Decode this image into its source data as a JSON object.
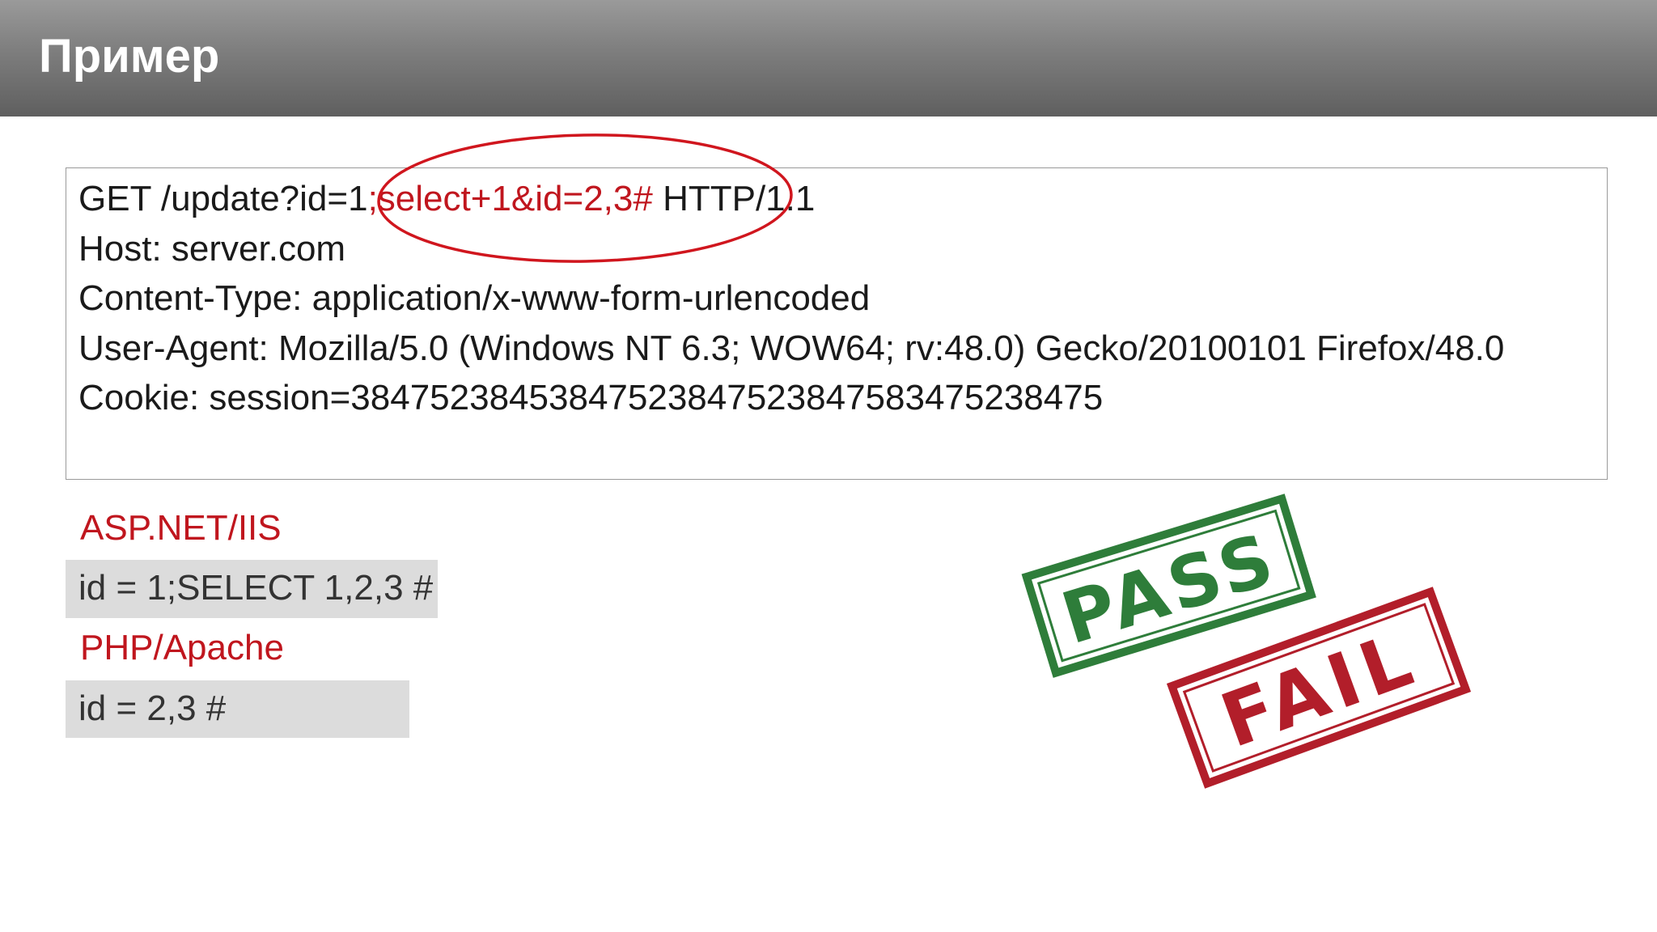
{
  "slide": {
    "title": "Пример"
  },
  "request": {
    "line1": {
      "before": "GET /update?id=1",
      "injected": ";select+1&id=2,3#",
      "after": " HTTP/1.1"
    },
    "host": "Host: server.com",
    "content_type": "Content-Type: application/x-www-form-urlencoded",
    "user_agent": "User-Agent: Mozilla/5.0 (Windows NT 6.3; WOW64; rv:48.0) Gecko/20100101 Firefox/48.0",
    "cookie": "Cookie: session=38475238453847523847523847583475238475"
  },
  "platforms": [
    {
      "label": "ASP.NET/IIS",
      "result": "id = 1;SELECT 1,2,3 #"
    },
    {
      "label": "PHP/Apache",
      "result": "id = 2,3 #"
    }
  ],
  "stamps": {
    "pass": "PASS",
    "fail": "FAIL"
  },
  "colors": {
    "accent_red": "#c0161e",
    "pass_green": "#2e7d3a",
    "fail_red": "#b21e2a",
    "result_bg": "#dcdcdc"
  },
  "icons": {
    "highlight": "red-ellipse-annotation",
    "pass_stamp": "pass-stamp-icon",
    "fail_stamp": "fail-stamp-icon"
  }
}
